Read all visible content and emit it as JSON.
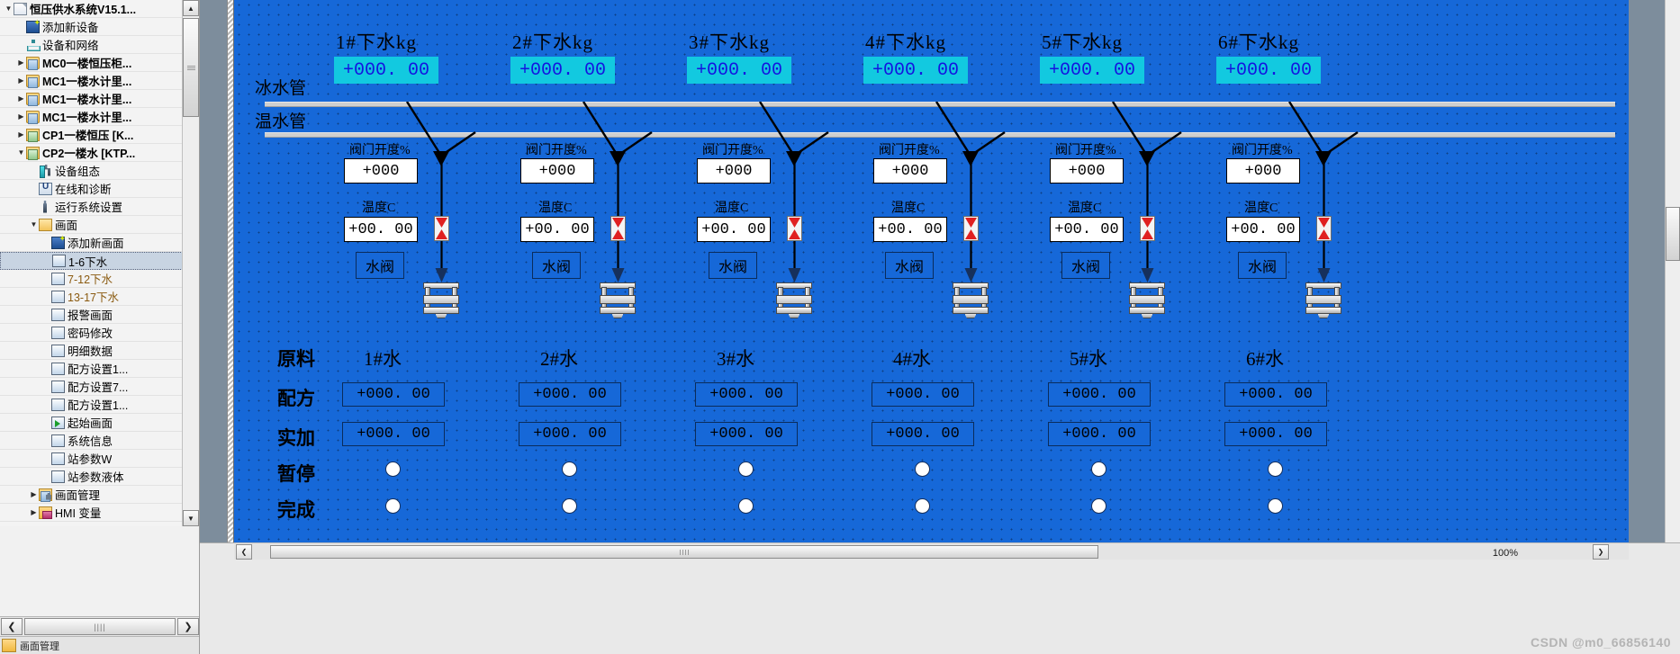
{
  "tree": {
    "root": {
      "label": "恒压供水系统V15.1...",
      "icon": "project-doc-icon"
    },
    "items": [
      {
        "label": "添加新设备",
        "icon": "add-device-icon",
        "indent": 1,
        "twisty": "",
        "icon_class": "ic-newdev",
        "bold": false
      },
      {
        "label": "设备和网络",
        "icon": "devices-networks-icon",
        "indent": 1,
        "twisty": "",
        "icon_class": "ic-net",
        "bold": false
      },
      {
        "label": "MC0一楼恒压柜...",
        "icon": "plc-folder-icon",
        "indent": 1,
        "twisty": "▶",
        "icon_class": "ic-folder",
        "bold": true
      },
      {
        "label": "MC1一楼水计里...",
        "icon": "plc-folder-icon",
        "indent": 1,
        "twisty": "▶",
        "icon_class": "ic-folder",
        "bold": true
      },
      {
        "label": "MC1一楼水计里...",
        "icon": "plc-folder-icon",
        "indent": 1,
        "twisty": "▶",
        "icon_class": "ic-folder",
        "bold": true
      },
      {
        "label": "MC1一楼水计里...",
        "icon": "plc-folder-icon",
        "indent": 1,
        "twisty": "▶",
        "icon_class": "ic-folder",
        "bold": true
      },
      {
        "label": "CP1一楼恒压 [K...",
        "icon": "hmi-folder-icon",
        "indent": 1,
        "twisty": "▶",
        "icon_class": "ic-folder-g",
        "bold": true
      },
      {
        "label": "CP2一楼水 [KTP...",
        "icon": "hmi-folder-icon",
        "indent": 1,
        "twisty": "▼",
        "icon_class": "ic-folder-g",
        "bold": true
      },
      {
        "label": "设备组态",
        "icon": "device-configuration-icon",
        "indent": 2,
        "twisty": "",
        "icon_class": "ic-cfg",
        "bold": false
      },
      {
        "label": "在线和诊断",
        "icon": "online-diagnostics-icon",
        "indent": 2,
        "twisty": "",
        "icon_class": "ic-diag",
        "bold": false
      },
      {
        "label": "运行系统设置",
        "icon": "runtime-settings-icon",
        "indent": 2,
        "twisty": "",
        "icon_class": "ic-wrench",
        "bold": false
      },
      {
        "label": "画面",
        "icon": "screens-folder-icon",
        "indent": 2,
        "twisty": "▼",
        "icon_class": "ic-folder-plain",
        "bold": false
      },
      {
        "label": "添加新画面",
        "icon": "add-screen-icon",
        "indent": 3,
        "twisty": "",
        "icon_class": "ic-newscreen",
        "bold": false
      },
      {
        "label": "1-6下水",
        "icon": "screen-icon",
        "indent": 3,
        "twisty": "",
        "icon_class": "ic-screen",
        "bold": false,
        "selected": true
      },
      {
        "label": "7-12下水",
        "icon": "screen-icon",
        "indent": 3,
        "twisty": "",
        "icon_class": "ic-screen",
        "bold": false,
        "orange": true
      },
      {
        "label": "13-17下水",
        "icon": "screen-icon",
        "indent": 3,
        "twisty": "",
        "icon_class": "ic-screen",
        "bold": false,
        "orange": true
      },
      {
        "label": "报警画面",
        "icon": "screen-icon",
        "indent": 3,
        "twisty": "",
        "icon_class": "ic-screen",
        "bold": false
      },
      {
        "label": "密码修改",
        "icon": "screen-icon",
        "indent": 3,
        "twisty": "",
        "icon_class": "ic-screen",
        "bold": false
      },
      {
        "label": "明细数据",
        "icon": "screen-icon",
        "indent": 3,
        "twisty": "",
        "icon_class": "ic-screen",
        "bold": false
      },
      {
        "label": "配方设置1...",
        "icon": "screen-icon",
        "indent": 3,
        "twisty": "",
        "icon_class": "ic-screen",
        "bold": false
      },
      {
        "label": "配方设置7...",
        "icon": "screen-icon",
        "indent": 3,
        "twisty": "",
        "icon_class": "ic-screen",
        "bold": false
      },
      {
        "label": "配方设置1...",
        "icon": "screen-icon",
        "indent": 3,
        "twisty": "",
        "icon_class": "ic-screen",
        "bold": false
      },
      {
        "label": "起始画面",
        "icon": "start-screen-icon",
        "indent": 3,
        "twisty": "",
        "icon_class": "ic-screen-start",
        "bold": false
      },
      {
        "label": "系统信息",
        "icon": "screen-icon",
        "indent": 3,
        "twisty": "",
        "icon_class": "ic-screen",
        "bold": false
      },
      {
        "label": "站参数W",
        "icon": "screen-icon",
        "indent": 3,
        "twisty": "",
        "icon_class": "ic-screen",
        "bold": false
      },
      {
        "label": "站参数液体",
        "icon": "screen-icon",
        "indent": 3,
        "twisty": "",
        "icon_class": "ic-screen",
        "bold": false
      },
      {
        "label": "画面管理",
        "icon": "screen-management-icon",
        "indent": 2,
        "twisty": "▶",
        "icon_class": "ic-mgmt",
        "bold": false
      },
      {
        "label": "HMI 变量",
        "icon": "hmi-tags-icon",
        "indent": 2,
        "twisty": "▶",
        "icon_class": "ic-hmivar",
        "bold": false
      }
    ],
    "scroll_left_label": "❮",
    "scroll_right_label": "❯",
    "scroll_up_label": "▲",
    "scroll_down_label": "▼"
  },
  "canvas": {
    "labels": {
      "ice_pipe": "冰水管",
      "warm_pipe": "温水管",
      "valve_opening": "阀门开度%",
      "temperature": "温度C",
      "water_valve_button": "水阀",
      "material": "原料",
      "recipe": "配方",
      "actual": "实加",
      "pause": "暂停",
      "complete": "完成"
    },
    "columns": [
      {
        "title": "1#下水kg",
        "drain_value": "+000. 00",
        "valve_value": "+000",
        "temp_value": "+00. 00",
        "material": "1#水",
        "recipe_value": "+000. 00",
        "actual_value": "+000. 00"
      },
      {
        "title": "2#下水kg",
        "drain_value": "+000. 00",
        "valve_value": "+000",
        "temp_value": "+00. 00",
        "material": "2#水",
        "recipe_value": "+000. 00",
        "actual_value": "+000. 00"
      },
      {
        "title": "3#下水kg",
        "drain_value": "+000. 00",
        "valve_value": "+000",
        "temp_value": "+00. 00",
        "material": "3#水",
        "recipe_value": "+000. 00",
        "actual_value": "+000. 00"
      },
      {
        "title": "4#下水kg",
        "drain_value": "+000. 00",
        "valve_value": "+000",
        "temp_value": "+00. 00",
        "material": "4#水",
        "recipe_value": "+000. 00",
        "actual_value": "+000. 00"
      },
      {
        "title": "5#下水kg",
        "drain_value": "+000. 00",
        "valve_value": "+000",
        "temp_value": "+00. 00",
        "material": "5#水",
        "recipe_value": "+000. 00",
        "actual_value": "+000. 00"
      },
      {
        "title": "6#下水kg",
        "drain_value": "+000. 00",
        "valve_value": "+000",
        "temp_value": "+00. 00",
        "material": "6#水",
        "recipe_value": "+000. 00",
        "actual_value": "+000. 00"
      }
    ],
    "colors": {
      "canvas_bg": "#1668d8",
      "value_field_bg": "#12c9e0",
      "value_field_text": "#1414e0",
      "pipe": "#cfcfcf",
      "valve_red": "#e02020"
    }
  },
  "status": {
    "zoom_level": "100%",
    "watermark": "CSDN @m0_66856140",
    "footer_label": "画面管理"
  }
}
